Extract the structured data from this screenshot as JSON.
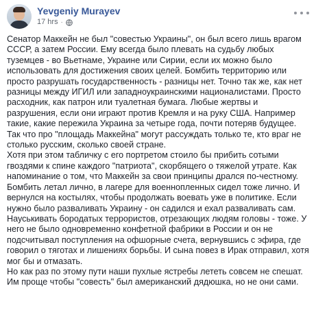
{
  "post": {
    "author": "Yevgeniy Murayev",
    "timestamp": "17 hrs",
    "separator": "·",
    "paragraphs": [
      "Сенатор Маккейн не был \"совестью Украины\", он был всего лишь врагом СССР, а затем России. Ему всегда было плевать на судьбу любых туземцев - во Вьетнаме, Украине или Сирии, если их можно было использовать для достижения своих целей. Бомбить территорию или просто разрушать государственность - разницы нет. Точно так же, как нет разницы между ИГИЛ или западноукраинскими националистами. Просто расходник, как патрон или туалетная бумага. Любые жертвы и разрушения, если они играют против Кремля и на руку США. Например такие, какие пережила Украина за четыре года, почти потеряв будущее. Так что про \"площадь Маккейна\" могут рассуждать только те, кто враг не столько русским, сколько своей стране.",
      "Хотя при этом табличку с его портретом стоило бы прибить сотыми гвоздями к спине каждого \"патриота\", скорбящего о тяжелой утрате. Как напоминание о том, что Маккейн за свои принципы дрался по-честному. Бомбить летал лично, в лагере для военнопленных сидел тоже лично. И вернулся на костылях, чтобы продолжать воевать уже в политике. Если нужно было разваливать Украину - он садился и ехал разваливать сам. Науськивать бородатых террористов, отрезающих людям головы - тоже. У него не было одновременно конфетной фабрики в России и он не подсчитывал поступления на офшорные счета, вернувшись с эфира, где говорил о тяготах и лишениях борьбы. И сына повез в Ирак отправил, хотя мог бы и отмазать.",
      "Но как раз по этому пути наши пухлые ястребы лететь совсем не спешат. Им проще чтобы \"совесть\" был американский дядюшка, но не они сами."
    ]
  },
  "icons": {
    "audience": "globe-icon",
    "menu": "more-options-icon",
    "avatar": "profile-photo"
  },
  "colors": {
    "name": "#385898",
    "text": "#1d2129",
    "meta": "#606770",
    "background": "#ffffff"
  }
}
